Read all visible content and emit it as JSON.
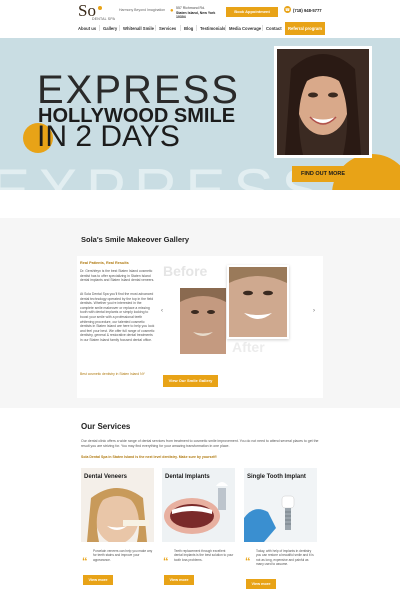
{
  "header": {
    "logo_text": "So",
    "logo_sub": "DENTAL SPA",
    "tagline": "Harmony Beyond Imagination",
    "address_l1": "557 Richmond Rd.",
    "address_l2": "Staten Island, New York",
    "address_l3": "10304",
    "book_label": "Book Appointment",
    "phone": "(718) 948-5777",
    "nav": [
      "About us",
      "Gallery",
      "Whitenall Smile",
      "Services",
      "Blog",
      "Testimonials",
      "Media Coverage",
      "Contact"
    ],
    "referral_label": "Referral program"
  },
  "hero": {
    "line1": "EXPRESS",
    "line2": "HOLLYWOOD SMILE",
    "line3": "IN 2 DAYS",
    "bg_text": "EXPRESS",
    "cta": "FIND OUT MORE"
  },
  "gallery": {
    "title": "Sola's Smile Makeover Gallery",
    "subtitle": "Real Patients, Real Results",
    "para1": "Dr. Gershfeyn is the best Staten Island cosmetic dentist has to offer specializing in Staten Island dental implants and Staten Island dental veneers.",
    "para2": "At Sola Dental Spa you'll find the most advanced dental technology operated by the top in the field dentists. Whether you're interested in the complete smile makeover or replace a missing tooth with dental implants or simply looking to boost your smile with a professional teeth whitening procedure, our talented cosmetic dentists in Staten Island are here to help you look and feel your best. We offer full range of cosmetic dentistry, general & restorative dental treatments in our Staten Island family focused dental office.",
    "link": "Best cosmetic dentistry in Staten Island NY",
    "before_label": "Before",
    "after_label": "After",
    "button": "View Our Smile Gallery",
    "arrow_prev": "‹",
    "arrow_next": "›"
  },
  "services": {
    "title": "Our Services",
    "intro": "Our dental clinic offers a wide range of dental services from treatment to cosmetic smile improvement. You do not need to attend several places to get the result you are striving for. You may find everything for your amazing transformation in one place.",
    "note": "Sola Dental Spa in Staten Island is the next level dentistry. Make sure by yourself!",
    "cards": [
      {
        "title": "Dental Veneers",
        "text": "Porcelain veneers can help you make any for teeth stains and improve your appearance.",
        "button": "View more"
      },
      {
        "title": "Dental Implants",
        "text": "Teeth replacement through excellent dental implants is the best solution to your tooth loss problems.",
        "button": "View more"
      },
      {
        "title": "Single Tooth Implant",
        "text": "Today, with help of implants in dentistry you can restore a beautiful smile and it is not as long, expensive and painful as many used to assume.",
        "button": "View more"
      }
    ]
  },
  "colors": {
    "accent": "#e8a317",
    "hero_bg": "#c9dde3"
  }
}
